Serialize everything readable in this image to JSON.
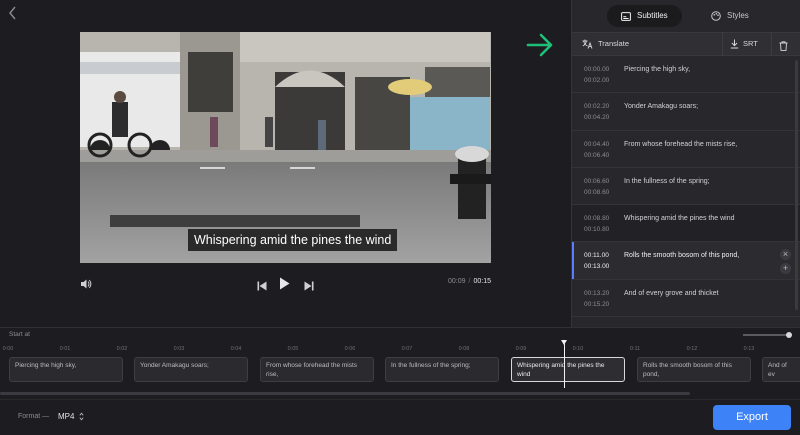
{
  "video": {
    "caption": "Whispering amid the pines the wind",
    "current_time": "00:09",
    "duration": "00:15",
    "icons": [
      "volume-icon",
      "skip-back-icon",
      "play-icon",
      "skip-forward-icon",
      "back-chevron-icon"
    ]
  },
  "panel": {
    "tabs": [
      {
        "label": "Subtitles",
        "icon": "subtitles-icon",
        "active": true
      },
      {
        "label": "Styles",
        "icon": "palette-icon",
        "active": false
      }
    ],
    "toolbar": {
      "translate_label": "Translate",
      "srt_label": "SRT"
    },
    "subtitles": [
      {
        "start": "00:00.00",
        "end": "00:02.00",
        "text": "Piercing the high sky,"
      },
      {
        "start": "00:02.20",
        "end": "00:04.20",
        "text": "Yonder Amakagu soars;"
      },
      {
        "start": "00:04.40",
        "end": "00:06.40",
        "text": "From whose forehead the mists rise,"
      },
      {
        "start": "00:06.60",
        "end": "00:08.60",
        "text": "In the fullness of the spring;"
      },
      {
        "start": "00:08.80",
        "end": "00:10.80",
        "text": "Whispering amid the pines the wind"
      },
      {
        "start": "00:11.00",
        "end": "00:13.00",
        "text": "Rolls the smooth bosom of this pond,"
      },
      {
        "start": "00:13.20",
        "end": "00:15.20",
        "text": "And of every grove and thicket"
      }
    ]
  },
  "timeline": {
    "start_label": "Start at",
    "ticks": [
      "0:00",
      "0:01",
      "0:02",
      "0:03",
      "0:04",
      "0:05",
      "0:06",
      "0:07",
      "0:08",
      "0:09",
      "0:10",
      "0:11",
      "0:12",
      "0:13"
    ],
    "clips": [
      "Piercing the high sky,",
      "Yonder Amakagu soars;",
      "From whose forehead the mists rise,",
      "In the fullness of the spring;",
      "Whispering amid the pines the wind",
      "Rolls the smooth bosom of this pond,",
      "And of ev"
    ]
  },
  "footer": {
    "format_label": "Format —",
    "format_value": "MP4",
    "export_label": "Export"
  },
  "colors": {
    "accent": "#3d82f6",
    "arrow": "#1fbf7a",
    "background": "#1d1d21",
    "panel": "#28282c"
  }
}
